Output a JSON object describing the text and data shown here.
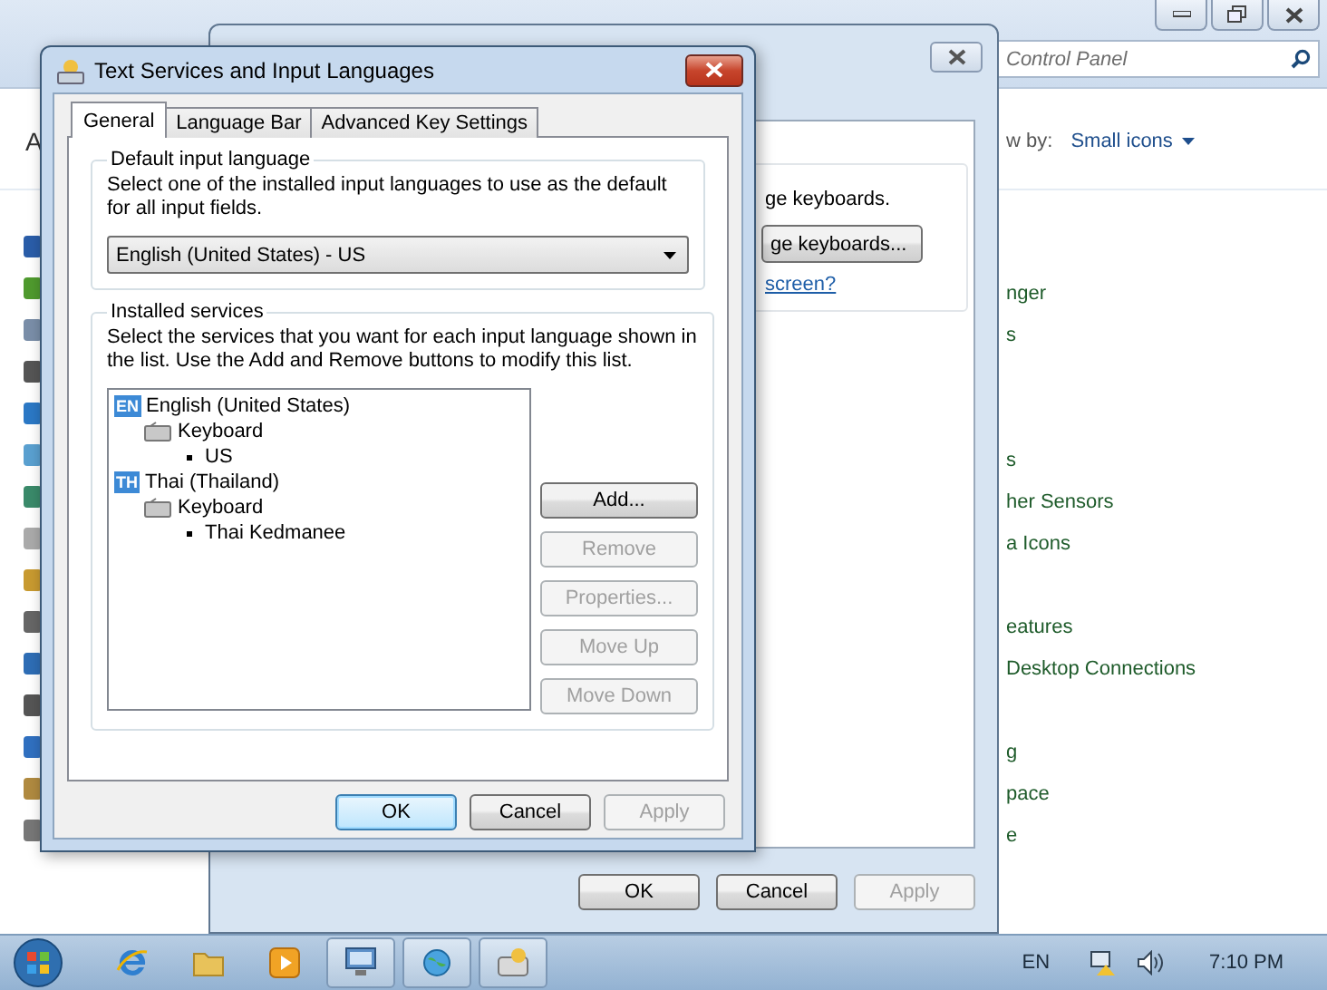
{
  "control_panel": {
    "address": "Control Panel",
    "heading_fragment": "A",
    "view_by_label": "w by:",
    "view_by_value": "Small icons",
    "items": [
      "nger",
      "s",
      "s",
      "her Sensors",
      "a Icons",
      "eatures",
      "Desktop Connections",
      "g",
      "pace",
      "e"
    ]
  },
  "region_window": {
    "description": "ge keyboards.",
    "change_button": "ge keyboards...",
    "link": "screen?",
    "buttons": [
      {
        "label": "OK",
        "disabled": false
      },
      {
        "label": "Cancel",
        "disabled": false
      },
      {
        "label": "Apply",
        "disabled": true
      }
    ]
  },
  "dialog": {
    "title": "Text Services and Input Languages",
    "tabs": [
      {
        "label": "General",
        "selected": true
      },
      {
        "label": "Language Bar",
        "selected": false
      },
      {
        "label": "Advanced Key Settings",
        "selected": false
      }
    ],
    "default_group": {
      "legend": "Default input language",
      "description": "Select one of the installed input languages to use as the default for all input fields.",
      "value": "English (United States) - US"
    },
    "services_group": {
      "legend": "Installed services",
      "description": "Select the services that you want for each input language shown in the list. Use the Add and Remove buttons to modify this list.",
      "tree": [
        {
          "kind": "language",
          "badge": "EN",
          "label": "English (United States)",
          "children": [
            {
              "kind": "category",
              "label": "Keyboard",
              "children": [
                {
                  "kind": "service",
                  "label": "US"
                }
              ]
            }
          ]
        },
        {
          "kind": "language",
          "badge": "TH",
          "label": "Thai (Thailand)",
          "children": [
            {
              "kind": "category",
              "label": "Keyboard",
              "children": [
                {
                  "kind": "service",
                  "label": "Thai Kedmanee"
                }
              ]
            }
          ]
        }
      ],
      "buttons": [
        {
          "label": "Add...",
          "disabled": false
        },
        {
          "label": "Remove",
          "disabled": true
        },
        {
          "label": "Properties...",
          "disabled": true
        },
        {
          "label": "Move Up",
          "disabled": true
        },
        {
          "label": "Move Down",
          "disabled": true
        }
      ]
    },
    "buttons": [
      {
        "label": "OK",
        "disabled": false,
        "focused": true
      },
      {
        "label": "Cancel",
        "disabled": false,
        "focused": false
      },
      {
        "label": "Apply",
        "disabled": true,
        "focused": false
      }
    ]
  },
  "taskbar": {
    "items": [
      {
        "kind": "browser",
        "running": false
      },
      {
        "kind": "folder",
        "running": false
      },
      {
        "kind": "media",
        "running": false
      },
      {
        "kind": "control-panel",
        "running": true
      },
      {
        "kind": "globe",
        "running": true
      },
      {
        "kind": "keyboard",
        "running": true
      }
    ],
    "language": "EN",
    "time": "7:10 PM"
  }
}
